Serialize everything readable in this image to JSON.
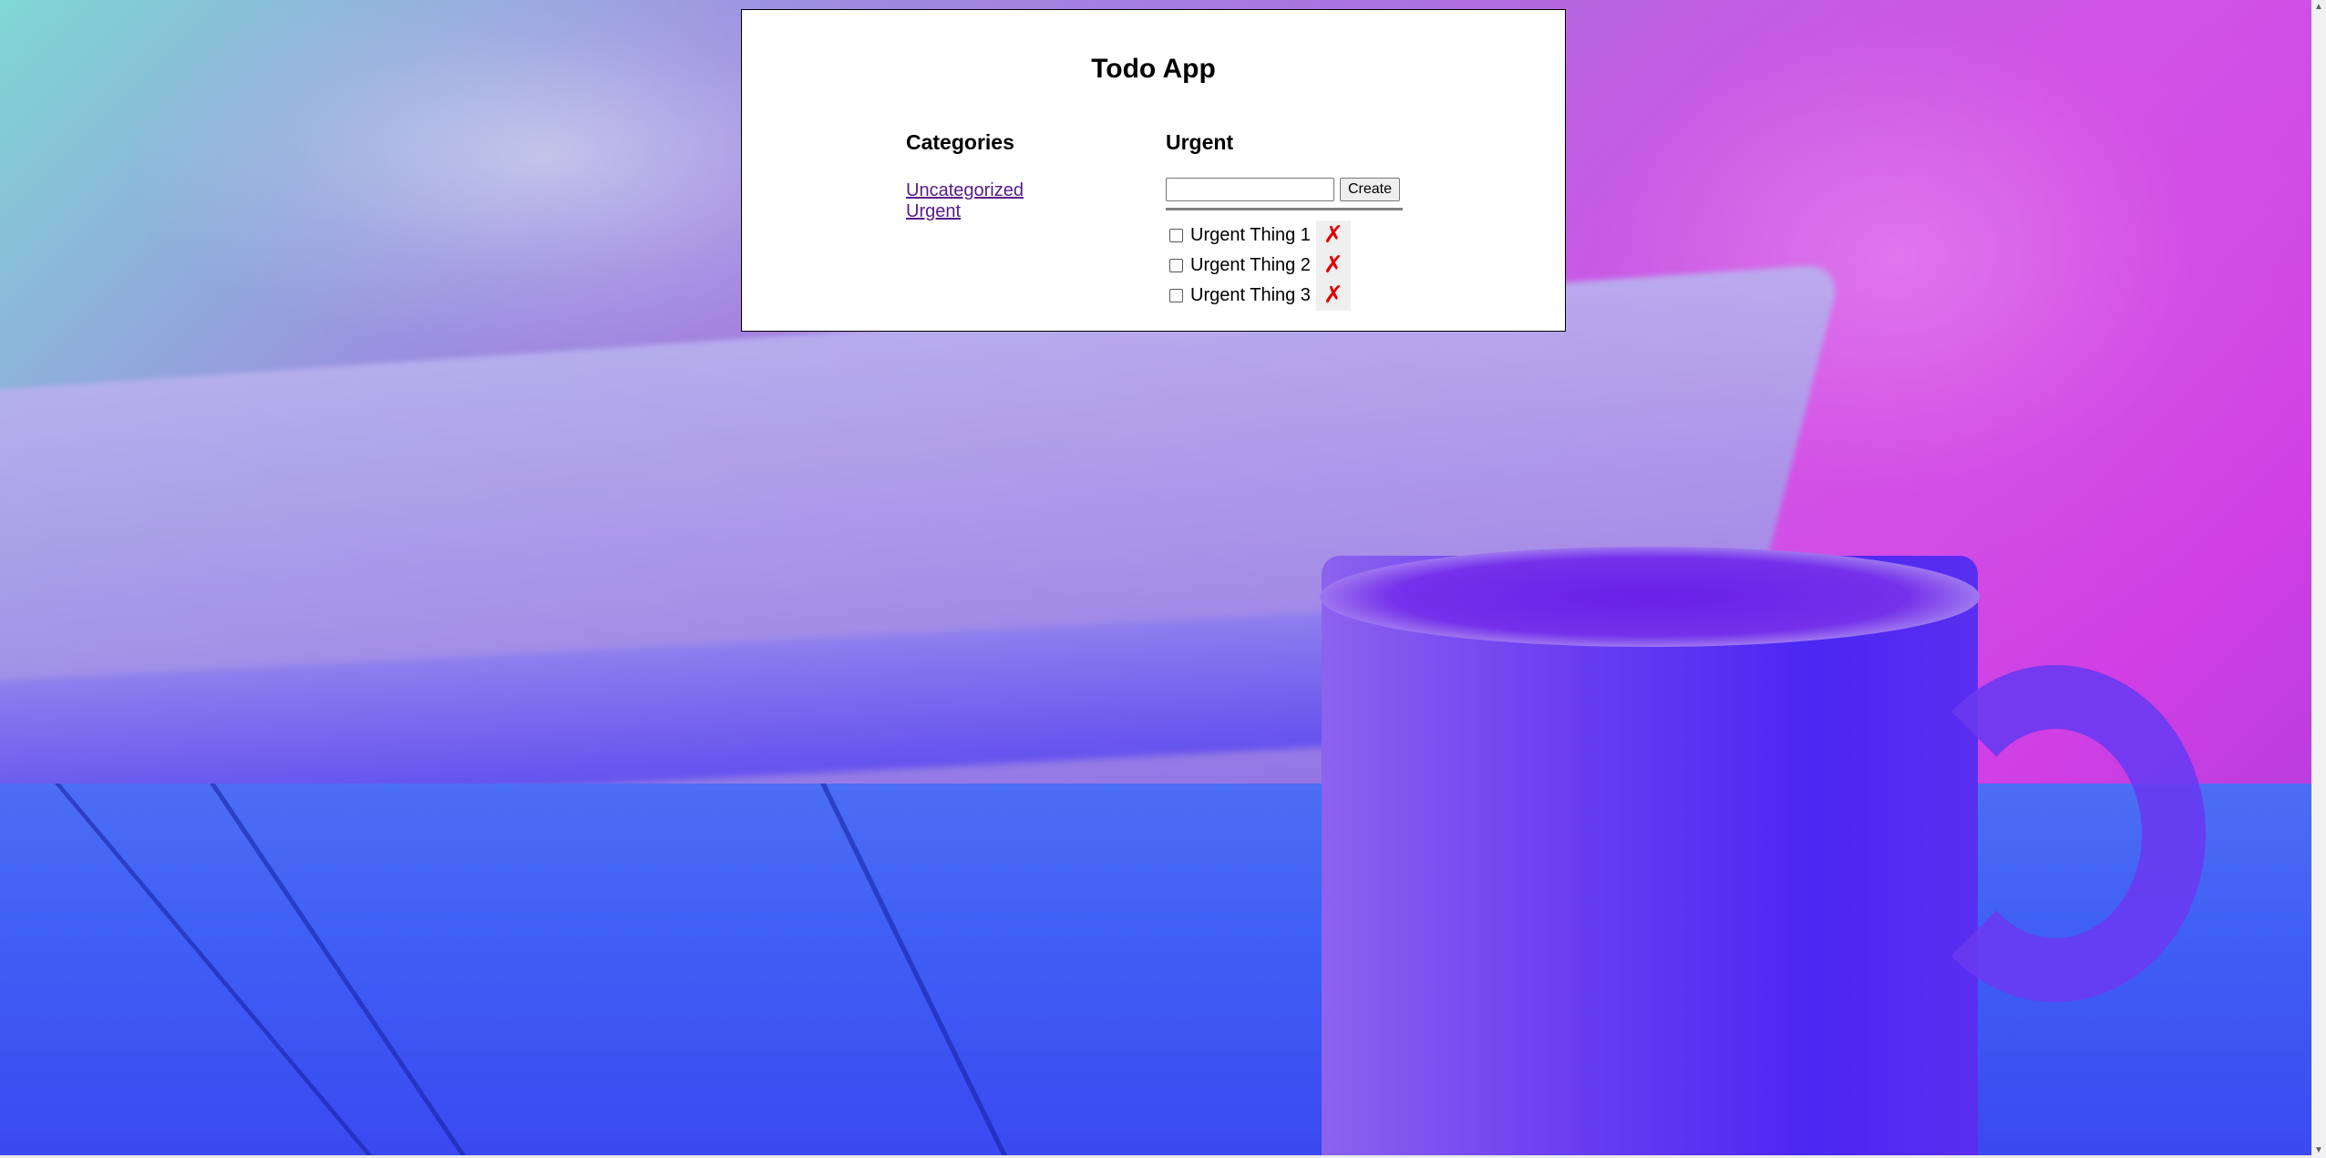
{
  "app": {
    "title": "Todo App"
  },
  "categories": {
    "heading": "Categories",
    "items": [
      {
        "label": "Uncategorized"
      },
      {
        "label": "Urgent"
      }
    ]
  },
  "todos": {
    "heading": "Urgent",
    "input": {
      "value": "",
      "placeholder": ""
    },
    "create_label": "Create",
    "delete_glyph": "✗",
    "items": [
      {
        "text": "Urgent Thing 1",
        "done": false
      },
      {
        "text": "Urgent Thing 2",
        "done": false
      },
      {
        "text": "Urgent Thing 3",
        "done": false
      }
    ]
  },
  "colors": {
    "link": "#551a8b",
    "delete": "#e00000"
  },
  "scrollbar": {
    "up_icon": "arrow-up-icon",
    "down_icon": "arrow-down-icon"
  }
}
